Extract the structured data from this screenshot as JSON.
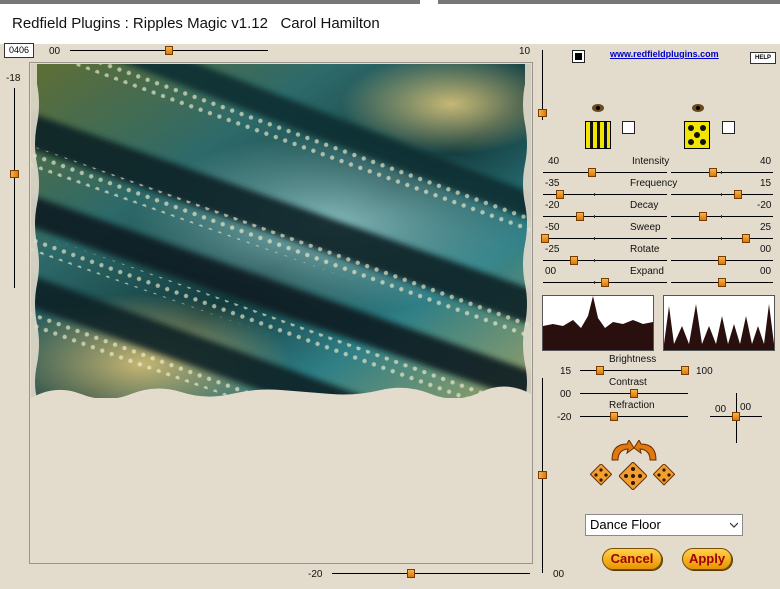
{
  "window": {
    "title": "Redfield Plugins : Ripples Magic v1.12   Carol Hamilton"
  },
  "preview": {
    "counter": "0406",
    "top_slider": {
      "min_label": "00",
      "max_label": "10",
      "value_fraction": 0.5
    },
    "left_slider": {
      "label": "-18",
      "value_fraction": 0.43
    },
    "bottom_slider": {
      "label": "-20",
      "value_fraction": 0.4
    }
  },
  "header": {
    "link_text": "www.redfieldplugins.com",
    "help_label": "HELP",
    "top_checkbox_checked": true
  },
  "patterns": {
    "left": {
      "name": "vertical-stripes-pattern",
      "checked": false
    },
    "right": {
      "name": "checker-pattern",
      "checked": false
    }
  },
  "params": [
    {
      "name": "Intensity",
      "left_value": "40",
      "right_value": "40",
      "left_fraction": 0.38,
      "right_fraction": 0.39
    },
    {
      "name": "Frequency",
      "left_value": "-35",
      "right_value": "15",
      "left_fraction": 0.12,
      "right_fraction": 0.64
    },
    {
      "name": "Decay",
      "left_value": "-20",
      "right_value": "-20",
      "left_fraction": 0.28,
      "right_fraction": 0.29
    },
    {
      "name": "Sweep",
      "left_value": "-50",
      "right_value": "25",
      "left_fraction": 0.0,
      "right_fraction": 0.72
    },
    {
      "name": "Rotate",
      "left_value": "-25",
      "right_value": "00",
      "left_fraction": 0.23,
      "right_fraction": 0.48
    },
    {
      "name": "Expand",
      "left_value": "00",
      "right_value": "00",
      "left_fraction": 0.48,
      "right_fraction": 0.48
    }
  ],
  "lighting": {
    "brightness": {
      "label": "Brightness",
      "min": "15",
      "max": "100",
      "value_fraction": 0.15,
      "max_fraction": 1.0
    },
    "contrast": {
      "label": "Contrast",
      "value": "00",
      "value_fraction": 0.5
    },
    "refraction": {
      "label": "Refraction",
      "value": "-20",
      "value_fraction": 0.4
    },
    "pad": {
      "x_label": "00",
      "y_label": "00"
    }
  },
  "right_vertical": {
    "bottom_label": "00",
    "top_fraction": 0.25,
    "bottom_fraction": 0.5
  },
  "preset": {
    "selected": "Dance Floor"
  },
  "buttons": {
    "cancel": "Cancel",
    "apply": "Apply"
  },
  "colors": {
    "background": "#e3dccd",
    "accent": "#e69500",
    "button_text": "#a00000",
    "link": "#0000c8"
  }
}
